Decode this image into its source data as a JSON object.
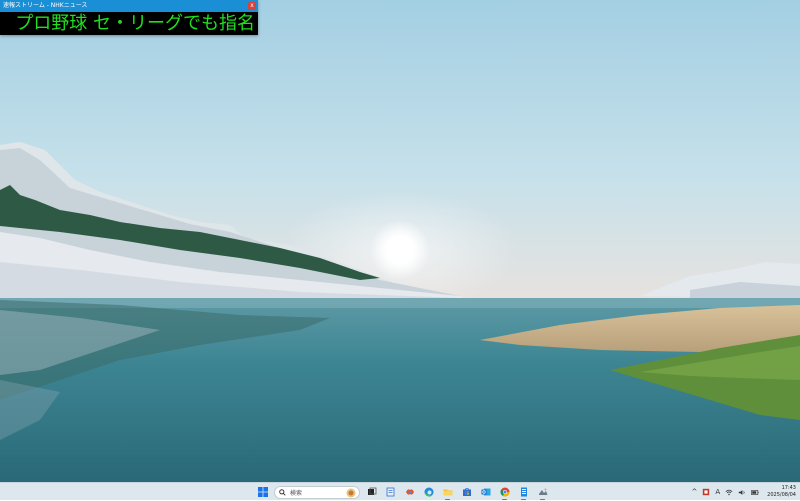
{
  "ticker": {
    "title": "速報ストリーム - NHKニュース",
    "close_label": "x",
    "headline": "プロ野球 セ・リーグでも指名"
  },
  "taskbar": {
    "search_placeholder": "検索",
    "tray": {
      "chevron": "^",
      "ime": "A",
      "time": "17:43",
      "date": "2025/08/04"
    },
    "apps": [
      "start-icon",
      "search",
      "file-manager-icon",
      "notepad-icon",
      "copilot-icon",
      "edge-icon",
      "file-explorer-icon",
      "store-icon",
      "outlook-icon",
      "chrome-icon",
      "notes-icon",
      "photos-icon"
    ]
  },
  "colors": {
    "ticker_text": "#1ee01e",
    "ticker_titlebar": "#1a8fd6",
    "taskbar_bg": "#dde7ee"
  }
}
